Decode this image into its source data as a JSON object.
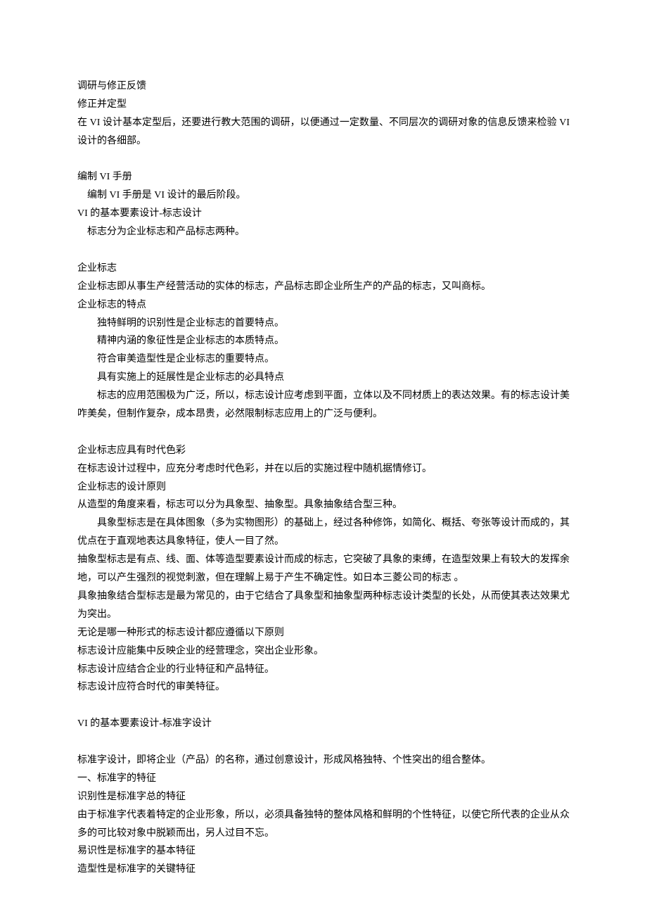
{
  "lines": {
    "l01": "调研与修正反馈",
    "l02": "修正并定型",
    "l03": "在 VI 设计基本定型后，还要进行教大范围的调研，以便通过一定数量、不同层次的调研对象的信息反馈来检验 VI 设计的各细部。",
    "l04": "编制 VI 手册",
    "l05": "编制 VI 手册是 VI 设计的最后阶段。",
    "l06": "VI 的基本要素设计-标志设计",
    "l07": "标志分为企业标志和产品标志两种。",
    "l08": "企业标志",
    "l09": "企业标志即从事生产经营活动的实体的标志，产品标志即企业所生产的产品的标志，又叫商标。",
    "l10": "企业标志的特点",
    "l11": "独特鲜明的识别性是企业标志的首要特点。",
    "l12": "精神内涵的象征性是企业标志的本质特点。",
    "l13": "符合审美造型性是企业标志的重要特点。",
    "l14": "具有实施上的延展性是企业标志的必具特点",
    "l15": "标志的应用范围极为广泛，所以，标志设计应考虑到平面，立体以及不同材质上的表达效果。有的标志设计美咋美矣，但制作复杂，成本昂贵，必然限制标志应用上的广泛与便利。",
    "l16": "企业标志应具有时代色彩",
    "l17": "在标志设计过程中，应充分考虑时代色彩，并在以后的实施过程中随机据情修订。",
    "l18": "企业标志的设计原则",
    "l19": "从造型的角度来看，标志可以分为具象型、抽象型。具象抽象结合型三种。",
    "l20": "具象型标志是在具体图象（多为实物图形）的基础上，经过各种修饰，如简化、概括、夸张等设计而成的，其优点在于直观地表达具象特征，使人一目了然。",
    "l21": "抽象型标志是有点、线、面、体等造型要素设计而成的标志，它突破了具象的束缚，在造型效果上有较大的发挥余地，可以产生强烈的视觉刺激，但在理解上易于产生不确定性。如日本三菱公司的标志 。",
    "l22": "具象抽象结合型标志是最为常见的，由于它结合了具象型和抽象型两种标志设计类型的长处，从而使其表达效果尤为突出。",
    "l23": "无论是哪一种形式的标志设计都应遵循以下原则",
    "l24": "标志设计应能集中反映企业的经营理念，突出企业形象。",
    "l25": "标志设计应结合企业的行业特征和产品特征。",
    "l26": "标志设计应符合时代的审美特征。",
    "l27": "VI 的基本要素设计-标准字设计",
    "l28": "标准字设计，即将企业（产品）的名称，通过创意设计，形成风格独特、个性突出的组合整体。",
    "l29": "一、标准字的特征",
    "l30": "识别性是标准字总的特征",
    "l31": "由于标准字代表着特定的企业形象，所以，必须具备独特的整体风格和鲜明的个性特征，以使它所代表的企业从众多的可比较对象中脱颖而出，另人过目不忘。",
    "l32": "易识性是标准字的基本特征",
    "l33": "造型性是标准字的关键特征"
  }
}
